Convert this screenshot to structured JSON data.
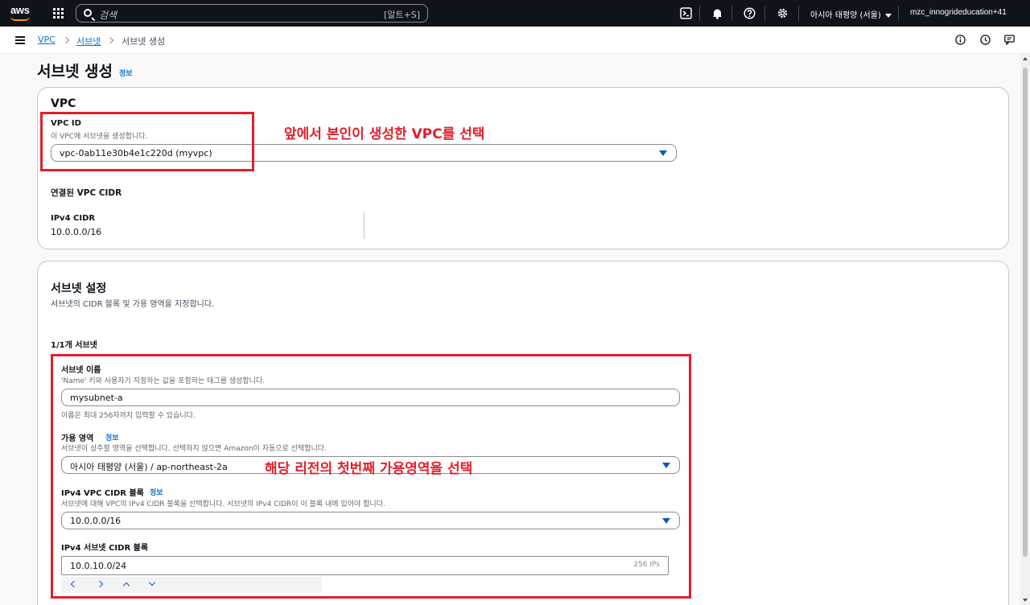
{
  "topbar": {
    "logo": "aws",
    "search_placeholder": "검색",
    "search_shortcut": "[알트+S]",
    "region": "아시아 태평양 (서울)",
    "account": "mzc_innogrideducation+41",
    "icons": [
      "cloudshell-icon",
      "bell-icon",
      "help-icon",
      "gear-icon"
    ]
  },
  "breadcrumb": {
    "items": [
      "VPC",
      "서브넷",
      "서브넷 생성"
    ]
  },
  "page": {
    "title": "서브넷 생성",
    "info": "정보"
  },
  "vpc_panel": {
    "heading": "VPC",
    "vpc_id_label": "VPC ID",
    "vpc_id_desc": "이 VPC에 서브넷을 생성합니다.",
    "vpc_id_value": "vpc-0ab11e30b4e1c220d (myvpc)",
    "annotation": "앞에서 본인이 생성한 VPC를 선택",
    "cidr_heading": "연결된 VPC CIDR",
    "ipv4_label": "IPv4 CIDR",
    "ipv4_value": "10.0.0.0/16"
  },
  "subnet_panel": {
    "heading": "서브넷 설정",
    "desc": "서브넷의 CIDR 블록 및 가용 영역을 지정합니다.",
    "count": "1/1개 서브넷",
    "name_label": "서브넷 이름",
    "name_desc": "'Name' 키와 사용자가 지정하는 값을 포함하는 태그를 생성합니다.",
    "name_value": "mysubnet-a",
    "name_hint": "이름은 최대 256자까지 입력할 수 있습니다.",
    "az_label": "가용 영역",
    "az_info": "정보",
    "az_desc": "서브넷이 상주할 영역을 선택합니다. 선택하지 않으면 Amazon이 자동으로 선택합니다.",
    "az_value": "아시아 태평양 (서울) / ap-northeast-2a",
    "annotation": "해당 리전의 첫번째 가용영역을 선택",
    "vpc_cidr_label": "IPv4 VPC CIDR 블록",
    "vpc_cidr_info": "정보",
    "vpc_cidr_desc": "서브넷에 대해 VPC의 IPv4 CIDR 블록을 선택합니다. 서브넷의 IPv4 CIDR이 이 블록 내에 있어야 합니다.",
    "vpc_cidr_value": "10.0.0.0/16",
    "subnet_cidr_label": "IPv4 서브넷 CIDR 블록",
    "subnet_cidr_value": "10.0.10.0/24",
    "subnet_cidr_suffix": "256 IPs"
  },
  "colors": {
    "annotation": "#e41e2b",
    "link": "#0972d3",
    "topbar": "#0f141a"
  }
}
